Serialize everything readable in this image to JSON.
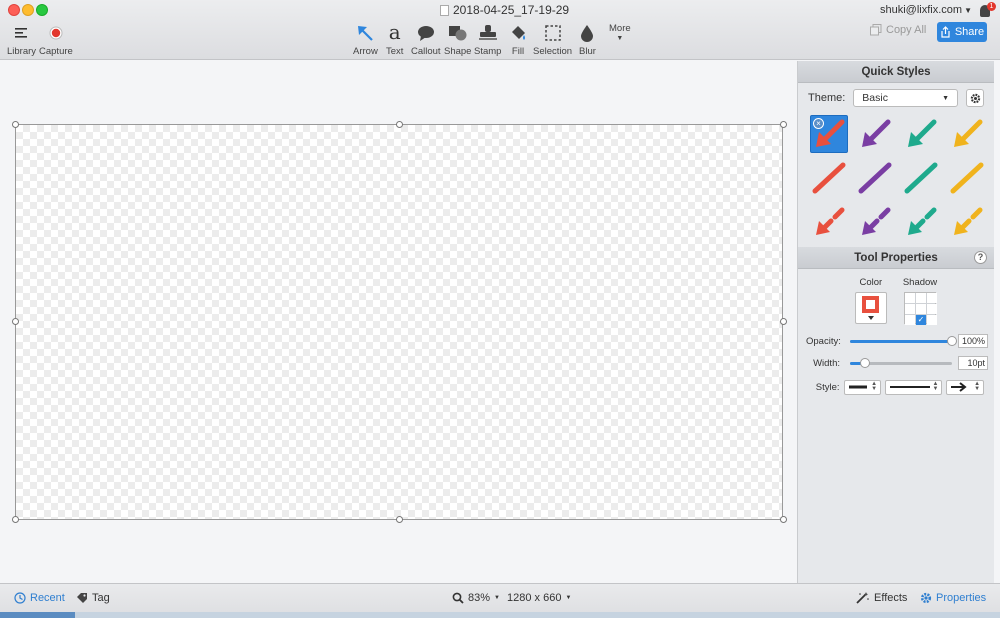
{
  "window": {
    "title": "2018-04-25_17-19-29",
    "account": "shuki@lixfix.com",
    "notification_count": "1"
  },
  "toolbar": {
    "library": "Library",
    "capture": "Capture",
    "tools": [
      {
        "name": "arrow",
        "label": "Arrow"
      },
      {
        "name": "text",
        "label": "Text"
      },
      {
        "name": "callout",
        "label": "Callout"
      },
      {
        "name": "shape",
        "label": "Shape"
      },
      {
        "name": "stamp",
        "label": "Stamp"
      },
      {
        "name": "fill",
        "label": "Fill"
      },
      {
        "name": "selection",
        "label": "Selection"
      },
      {
        "name": "blur",
        "label": "Blur"
      }
    ],
    "more": "More",
    "copy_all": "Copy All",
    "share": "Share",
    "text_glyph": "a",
    "accent_color": "#2f86dd"
  },
  "quick_styles": {
    "title": "Quick Styles",
    "theme_label": "Theme:",
    "theme_value": "Basic",
    "colors": [
      "#e8503e",
      "#7a3ea3",
      "#1faa8d",
      "#f0b31d"
    ],
    "rows": [
      "arrow",
      "line",
      "dashed-arrow"
    ],
    "selected_index": 0
  },
  "tool_properties": {
    "title": "Tool Properties",
    "help": "?",
    "color_label": "Color",
    "shadow_label": "Shadow",
    "shadow_checked": true,
    "current_color": "#e8503e",
    "opacity_label": "Opacity:",
    "opacity_value": "100%",
    "opacity_fraction": 1.0,
    "width_label": "Width:",
    "width_value": "10pt",
    "width_fraction": 0.15,
    "style_label": "Style:"
  },
  "statusbar": {
    "recent": "Recent",
    "tag": "Tag",
    "zoom": "83%",
    "dimensions": "1280 x 660",
    "effects": "Effects",
    "properties": "Properties"
  }
}
